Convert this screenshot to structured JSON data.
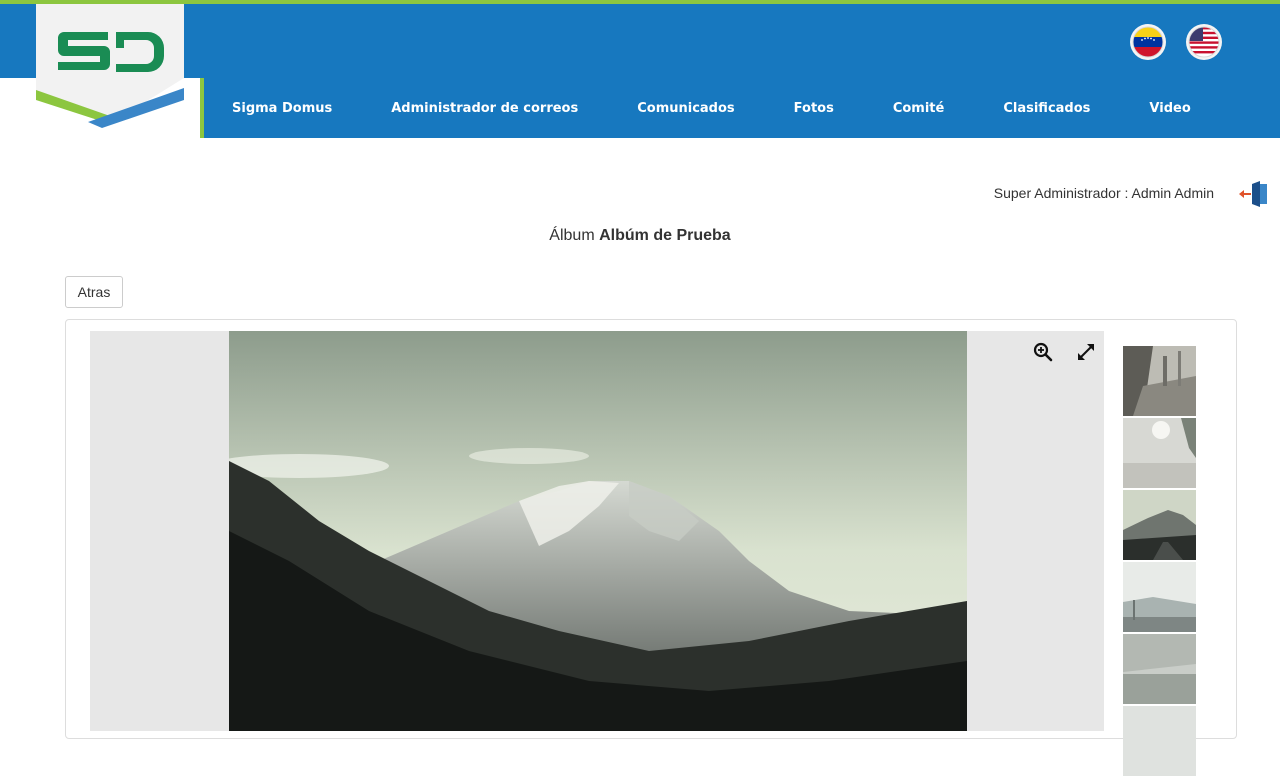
{
  "brand": {
    "logo_text": "SD"
  },
  "nav": {
    "items": [
      {
        "label": "Sigma Domus"
      },
      {
        "label": "Administrador de correos"
      },
      {
        "label": "Comunicados"
      },
      {
        "label": "Fotos"
      },
      {
        "label": "Comité"
      },
      {
        "label": "Clasificados"
      },
      {
        "label": "Video"
      }
    ]
  },
  "languages": [
    {
      "icon": "venezuela-flag-icon"
    },
    {
      "icon": "usa-flag-icon"
    }
  ],
  "user": {
    "role": "Super Administrador",
    "separator": " : ",
    "name": "Admin Admin"
  },
  "album": {
    "prefix": "Álbum",
    "name": "Albúm de Prueba"
  },
  "buttons": {
    "back": "Atras"
  },
  "viewer": {
    "tools": [
      "zoom-in-icon",
      "fullscreen-icon"
    ]
  },
  "colors": {
    "brand_blue": "#1778bf",
    "brand_green": "#8cc63f",
    "logo_green": "#1a8c54"
  }
}
